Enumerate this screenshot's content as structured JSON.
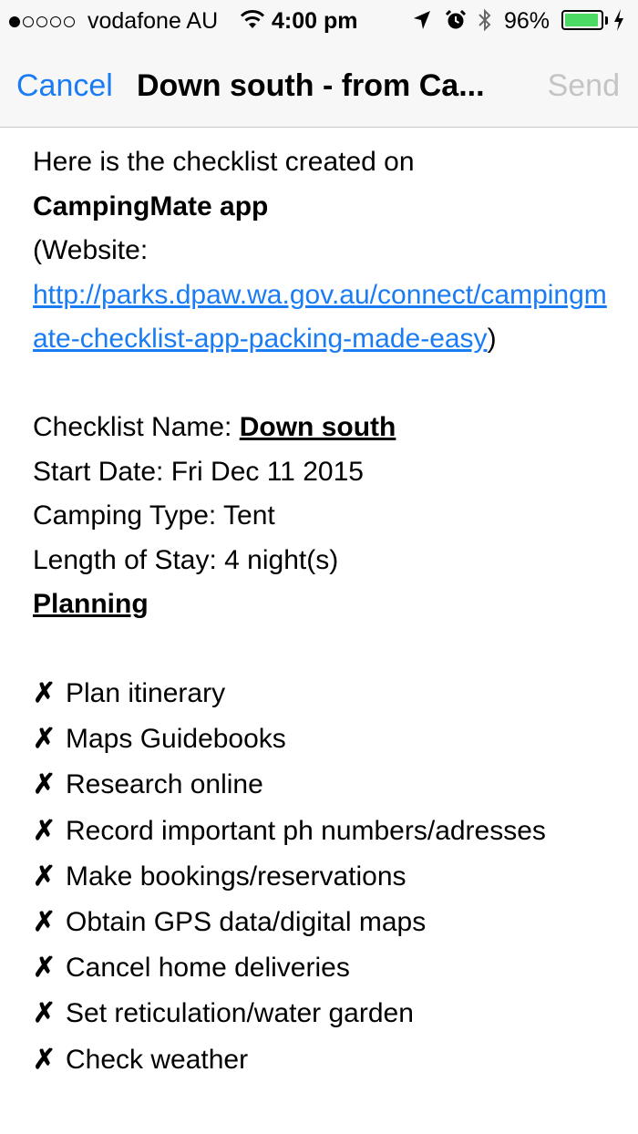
{
  "status_bar": {
    "carrier": "vodafone AU",
    "time": "4:00 pm",
    "battery_percent": "96%",
    "battery_level": 0.96,
    "signal_bars_filled": 1,
    "signal_bars_total": 5,
    "icons": [
      "signal-dots-icon",
      "wifi-icon",
      "location-arrow-icon",
      "alarm-icon",
      "bluetooth-icon",
      "battery-icon",
      "charging-bolt-icon"
    ]
  },
  "nav": {
    "cancel_label": "Cancel",
    "title": "Down south - from Ca...",
    "send_label": "Send",
    "accent_color": "#1a7cf4",
    "disabled_color": "#c4c4c7"
  },
  "message": {
    "intro_line": "Here is the checklist created on",
    "app_name": "CampingMate app",
    "website_label": "(Website:",
    "website_url": "http://parks.dpaw.wa.gov.au/connect/campingmate-checklist-app-packing-made-easy",
    "website_close": ")",
    "checklist_name_label": "Checklist Name: ",
    "checklist_name": "Down south",
    "start_date": "Start Date: Fri Dec 11 2015",
    "camping_type": "Camping Type: Tent",
    "length_of_stay": "Length of Stay: 4 night(s)",
    "section_heading": "Planning",
    "check_symbol": "✗",
    "items": [
      "Plan itinerary",
      "Maps Guidebooks",
      "Research online",
      "Record important ph numbers/adresses",
      "Make bookings/reservations",
      "Obtain GPS data/digital maps",
      "Cancel home deliveries",
      "Set reticulation/water garden",
      "Check weather"
    ]
  }
}
